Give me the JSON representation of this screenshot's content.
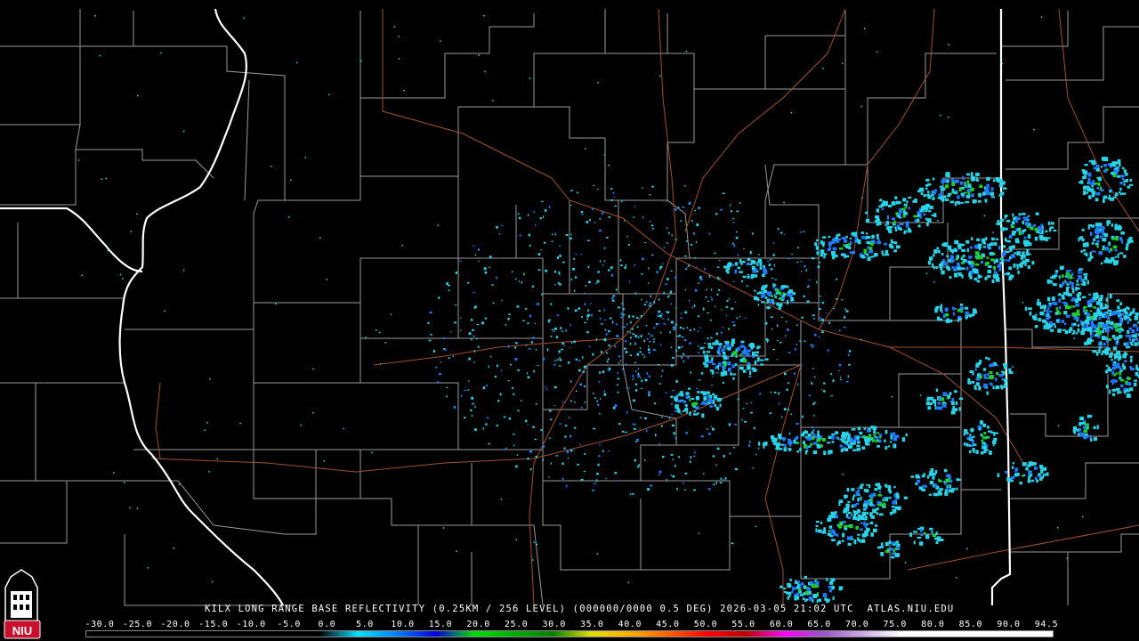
{
  "caption": "KILX LONG RANGE BASE REFLECTIVITY (0.25KM / 256 LEVEL) (000000/0000 0.5 DEG) 2026-03-05 21:02 UTC  ATLAS.NIU.EDU",
  "logo": {
    "text": "NIU",
    "icon": "niu-tower-shield-icon",
    "colors": {
      "shield": "#c8102e",
      "outline": "#ffffff"
    }
  },
  "colorbar": {
    "ticks": [
      "-30.0",
      "-25.0",
      "-20.0",
      "-15.0",
      "-10.0",
      "-5.0",
      "0.0",
      "5.0",
      "10.0",
      "15.0",
      "20.0",
      "25.0",
      "30.0",
      "35.0",
      "40.0",
      "45.0",
      "50.0",
      "55.0",
      "60.0",
      "65.0",
      "70.0",
      "75.0",
      "80.0",
      "85.0",
      "90.0",
      "94.5"
    ],
    "stops": [
      {
        "dbz": -30,
        "color": "#000000"
      },
      {
        "dbz": 0,
        "color": "#000000"
      },
      {
        "dbz": 5,
        "color": "#00e5ff"
      },
      {
        "dbz": 10,
        "color": "#0080ff"
      },
      {
        "dbz": 15,
        "color": "#0000e0"
      },
      {
        "dbz": 20,
        "color": "#00e000"
      },
      {
        "dbz": 25,
        "color": "#00b000"
      },
      {
        "dbz": 30,
        "color": "#008000"
      },
      {
        "dbz": 35,
        "color": "#e0e000"
      },
      {
        "dbz": 40,
        "color": "#ffb000"
      },
      {
        "dbz": 45,
        "color": "#ff6000"
      },
      {
        "dbz": 50,
        "color": "#ff0000"
      },
      {
        "dbz": 55,
        "color": "#c00000"
      },
      {
        "dbz": 60,
        "color": "#ff00ff"
      },
      {
        "dbz": 65,
        "color": "#9955cc"
      },
      {
        "dbz": 75,
        "color": "#ffffff"
      },
      {
        "dbz": 94.5,
        "color": "#ffffff"
      }
    ]
  },
  "colors": {
    "background": "#000000",
    "county_lines": "#9a9a9a",
    "state_lines": "#ffffff",
    "roads": "#a0522d",
    "echo_light": "#2ad4e8",
    "echo_medium": "#1e7bff",
    "echo_heavy": "#1ccf2c"
  }
}
